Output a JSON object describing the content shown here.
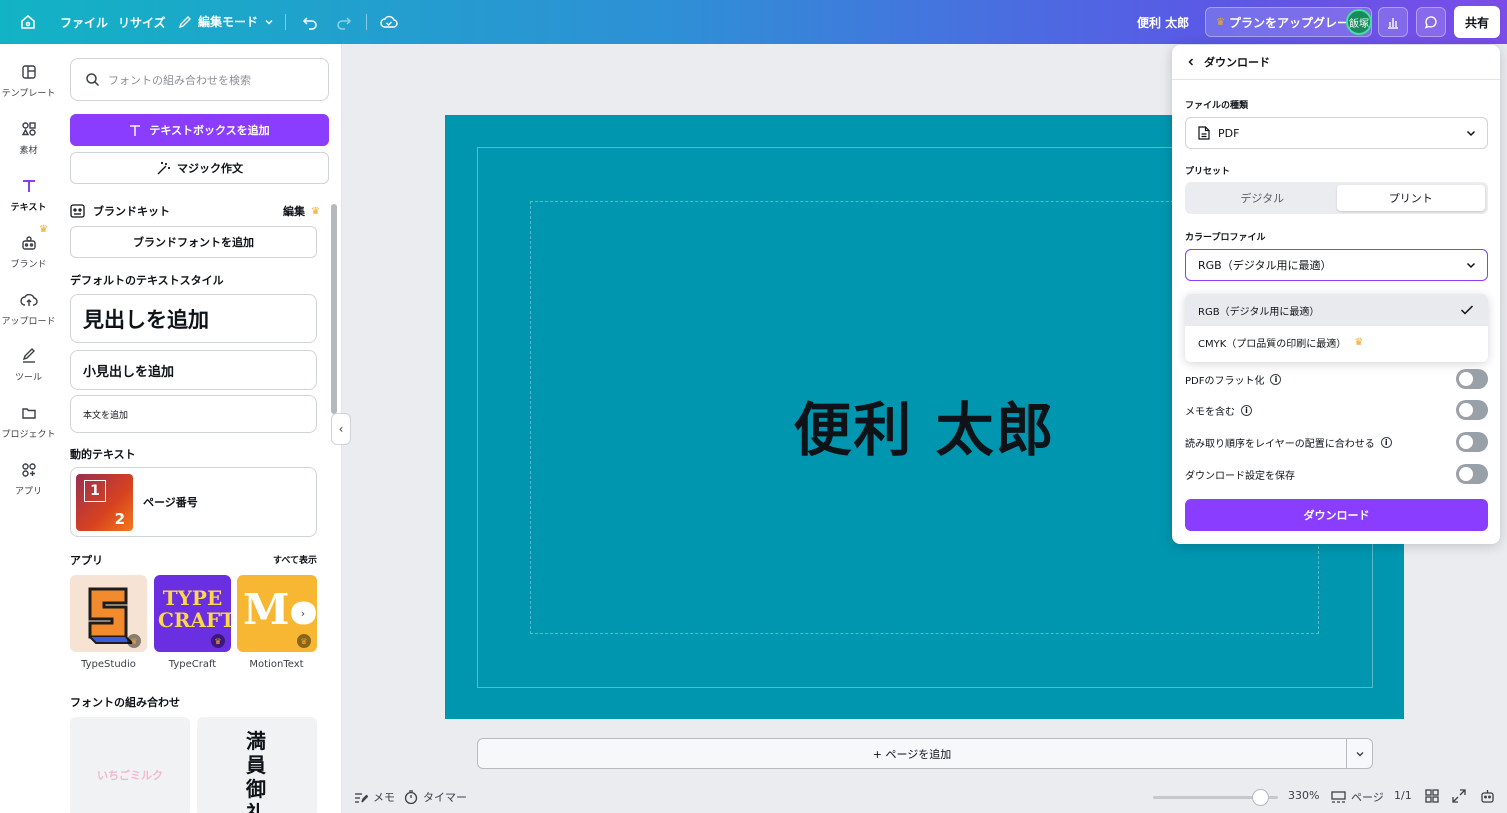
{
  "topbar": {
    "file": "ファイル",
    "resize": "リサイズ",
    "edit_mode": "編集モード",
    "user_name": "便利 太郎",
    "upgrade": "プランをアップグレード",
    "avatar": "飯塚",
    "share": "共有"
  },
  "rail": {
    "items": [
      {
        "label": "テンプレート",
        "icon": "template-icon"
      },
      {
        "label": "素材",
        "icon": "elements-icon"
      },
      {
        "label": "テキスト",
        "icon": "text-icon"
      },
      {
        "label": "ブランド",
        "icon": "brand-icon"
      },
      {
        "label": "アップロード",
        "icon": "upload-icon"
      },
      {
        "label": "ツール",
        "icon": "draw-icon"
      },
      {
        "label": "プロジェクト",
        "icon": "folder-icon"
      },
      {
        "label": "アプリ",
        "icon": "apps-icon"
      }
    ]
  },
  "panel": {
    "search_placeholder": "フォントの組み合わせを検索",
    "add_textbox": "テキストボックスを追加",
    "magic_write": "マジック作文",
    "brand_kit": "ブランドキット",
    "brand_edit": "編集",
    "add_brand_font": "ブランドフォントを追加",
    "default_styles": "デフォルトのテキストスタイル",
    "heading": "見出しを追加",
    "subheading": "小見出しを追加",
    "body": "本文を追加",
    "dynamic_text": "動的テキスト",
    "page_number": "ページ番号",
    "page_number_digit_top": "1",
    "page_number_digit_bottom": "2",
    "apps_title": "アプリ",
    "see_all": "すべて表示",
    "apps": [
      {
        "name": "TypeStudio",
        "color": "#f4a8a0"
      },
      {
        "name": "TypeCraft",
        "color": "#6a2fe0"
      },
      {
        "name": "MotionText",
        "color": "#f7b733"
      }
    ],
    "typecraft_art": "TYPE CRAFT",
    "motion_art": "Mo",
    "font_combos_title": "フォントの組み合わせ",
    "font_combo_1": "いちごミルク",
    "font_combo_2": "満員御礼"
  },
  "canvas": {
    "text": "便利 太郎",
    "bg_color": "#0096b0"
  },
  "add_page": "+ ページを追加",
  "footer": {
    "notes": "メモ",
    "timer": "タイマー",
    "zoom": "330%",
    "zoom_level": 0.82,
    "pages_label": "ページ",
    "page_count": "1/1"
  },
  "download": {
    "title": "ダウンロード",
    "file_type_label": "ファイルの種類",
    "file_type": "PDF",
    "preset_label": "プリセット",
    "preset_digital": "デジタル",
    "preset_print": "プリント",
    "color_profile_label": "カラープロファイル",
    "color_profile": "RGB（デジタル用に最適）",
    "options": [
      {
        "label": "RGB（デジタル用に最適）",
        "selected": true
      },
      {
        "label": "CMYK（プロ品質の印刷に最適）",
        "selected": false
      }
    ],
    "toggles": [
      {
        "label": "PDFのフラット化",
        "info": true,
        "on": false
      },
      {
        "label": "メモを含む",
        "info": true,
        "on": false
      },
      {
        "label": "読み取り順序をレイヤーの配置に合わせる",
        "info": true,
        "on": false
      },
      {
        "label": "ダウンロード設定を保存",
        "info": false,
        "on": false
      }
    ],
    "button": "ダウンロード"
  }
}
